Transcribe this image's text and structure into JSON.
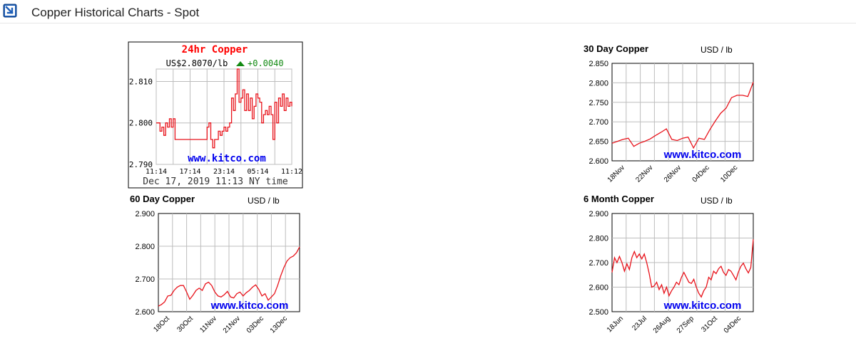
{
  "page": {
    "title": "Copper Historical Charts - Spot"
  },
  "icons": {
    "header": "arrow-down-right-icon"
  },
  "colors": {
    "line": "#e8131b",
    "grid": "#bdbdbd",
    "watermark": "#0000ee",
    "up": "#128a12",
    "title24": "#ff0000"
  },
  "chart_data": [
    {
      "type": "line",
      "title": "24hr Copper",
      "quote": "US$2.8070/lb",
      "change": "+0.0040",
      "change_direction": "up",
      "timestamp": "Dec 17, 2019 11:13 NY time",
      "watermark": "www.kitco.com",
      "ylim": [
        2.79,
        2.813
      ],
      "y_ticks": [
        "2.810",
        "2.800",
        "2.790"
      ],
      "x_ticks": [
        "11:14",
        "17:14",
        "23:14",
        "05:14",
        "11:12"
      ],
      "series": [
        {
          "values": [
            2.8,
            2.8,
            2.798,
            2.799,
            2.797,
            2.8,
            2.799,
            2.801,
            2.799,
            2.801,
            2.796,
            2.796,
            2.796,
            2.796,
            2.796,
            2.796,
            2.796,
            2.796,
            2.796,
            2.796,
            2.796,
            2.796,
            2.796,
            2.796,
            2.796,
            2.796,
            2.796,
            2.799,
            2.8,
            2.796,
            2.794,
            2.796,
            2.796,
            2.798,
            2.797,
            2.798,
            2.799,
            2.798,
            2.799,
            2.8,
            2.806,
            2.803,
            2.807,
            2.813,
            2.805,
            2.806,
            2.808,
            2.803,
            2.807,
            2.803,
            2.806,
            2.801,
            2.804,
            2.807,
            2.806,
            2.805,
            2.8,
            2.802,
            2.803,
            2.802,
            2.804,
            2.802,
            2.796,
            2.805,
            2.8,
            2.806,
            2.804,
            2.807,
            2.803,
            2.806,
            2.804,
            2.805,
            2.804
          ]
        }
      ]
    },
    {
      "type": "line",
      "title": "30 Day Copper",
      "units": "USD / lb",
      "watermark": "www.kitco.com",
      "ylim": [
        2.6,
        2.85
      ],
      "y_ticks": [
        "2.850",
        "2.800",
        "2.750",
        "2.700",
        "2.650",
        "2.600"
      ],
      "x_ticks": [
        "18Nov",
        "22Nov",
        "26Nov",
        "04Dec",
        "10Dec"
      ],
      "series": [
        {
          "values": [
            2.645,
            2.65,
            2.655,
            2.658,
            2.637,
            2.645,
            2.65,
            2.656,
            2.665,
            2.673,
            2.682,
            2.655,
            2.652,
            2.658,
            2.661,
            2.633,
            2.658,
            2.655,
            2.68,
            2.702,
            2.722,
            2.735,
            2.762,
            2.768,
            2.768,
            2.765,
            2.802
          ]
        }
      ]
    },
    {
      "type": "line",
      "title": "60 Day Copper",
      "units": "USD / lb",
      "watermark": "www.kitco.com",
      "ylim": [
        2.6,
        2.9
      ],
      "y_ticks": [
        "2.900",
        "2.800",
        "2.700",
        "2.600"
      ],
      "x_ticks": [
        "18Oct",
        "30Oct",
        "11Nov",
        "21Nov",
        "03Dec",
        "13Dec"
      ],
      "series": [
        {
          "values": [
            2.617,
            2.622,
            2.63,
            2.648,
            2.65,
            2.665,
            2.675,
            2.68,
            2.68,
            2.66,
            2.638,
            2.65,
            2.665,
            2.672,
            2.665,
            2.685,
            2.69,
            2.68,
            2.66,
            2.648,
            2.645,
            2.652,
            2.662,
            2.645,
            2.642,
            2.655,
            2.66,
            2.648,
            2.658,
            2.665,
            2.675,
            2.682,
            2.668,
            2.648,
            2.655,
            2.635,
            2.645,
            2.655,
            2.68,
            2.71,
            2.735,
            2.755,
            2.765,
            2.77,
            2.78,
            2.798
          ]
        }
      ]
    },
    {
      "type": "line",
      "title": "6 Month Copper",
      "units": "USD / lb",
      "watermark": "www.kitco.com",
      "ylim": [
        2.5,
        2.9
      ],
      "y_ticks": [
        "2.900",
        "2.800",
        "2.700",
        "2.600",
        "2.500"
      ],
      "x_ticks": [
        "18Jun",
        "23Jul",
        "26Aug",
        "27Sep",
        "31Oct",
        "04Dec"
      ],
      "series": [
        {
          "values": [
            2.66,
            2.72,
            2.7,
            2.725,
            2.7,
            2.665,
            2.695,
            2.672,
            2.72,
            2.745,
            2.72,
            2.735,
            2.715,
            2.735,
            2.7,
            2.655,
            2.6,
            2.605,
            2.62,
            2.59,
            2.61,
            2.575,
            2.6,
            2.565,
            2.585,
            2.6,
            2.62,
            2.61,
            2.64,
            2.66,
            2.64,
            2.62,
            2.615,
            2.632,
            2.6,
            2.575,
            2.56,
            2.585,
            2.6,
            2.64,
            2.63,
            2.665,
            2.655,
            2.675,
            2.685,
            2.66,
            2.648,
            2.672,
            2.665,
            2.648,
            2.63,
            2.662,
            2.685,
            2.698,
            2.675,
            2.658,
            2.68,
            2.795
          ]
        }
      ]
    }
  ]
}
